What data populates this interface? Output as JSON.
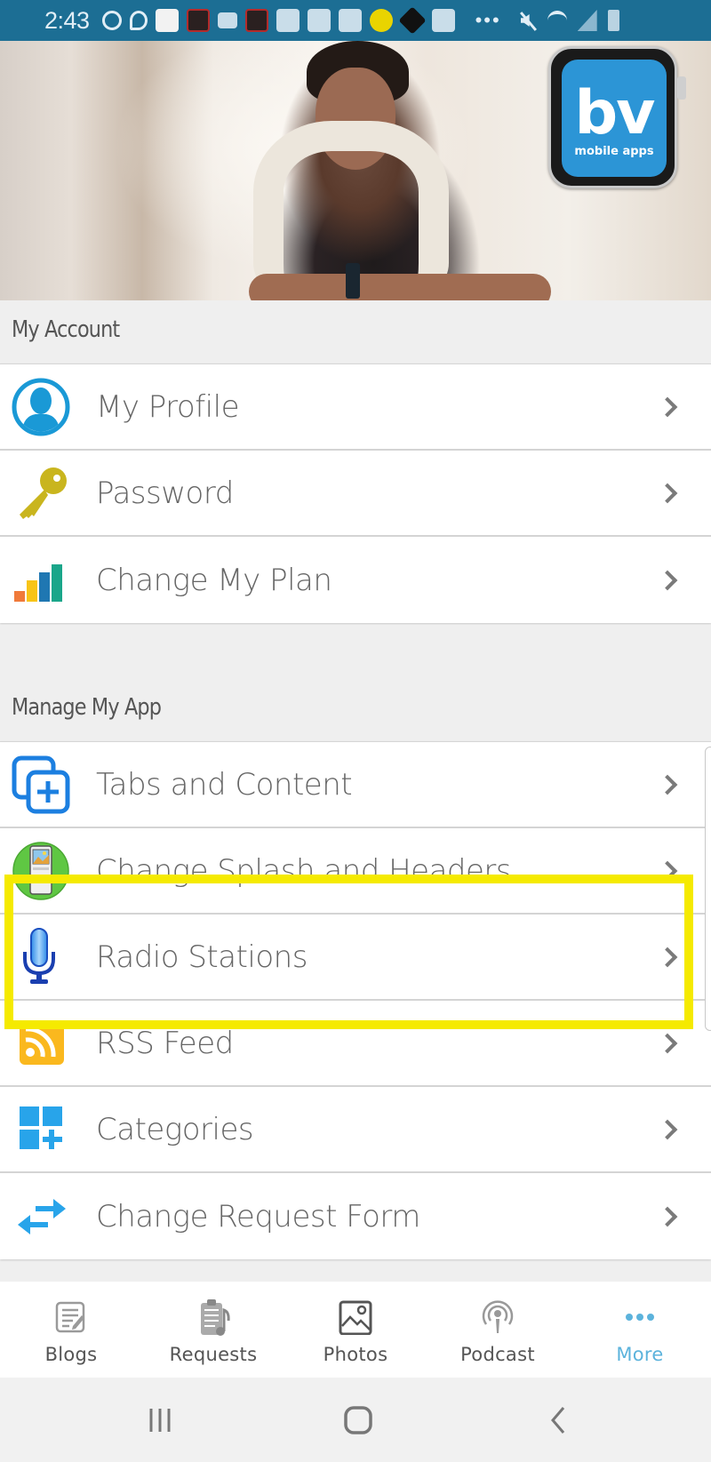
{
  "status_bar": {
    "time": "2:43",
    "notification_icons": [
      "circle-icon",
      "swirl-icon",
      "app-icon",
      "app-icon",
      "teams-icon",
      "app-icon",
      "trophy-icon",
      "app-icon",
      "trophy-icon",
      "cross-badge-icon",
      "diamond-app-icon",
      "app-icon"
    ],
    "overflow": "•••",
    "system_icons": [
      "mute-icon",
      "wifi-icon",
      "signal-icon",
      "battery-icon"
    ]
  },
  "hero": {
    "brand_letters": "bv",
    "brand_tagline": "mobile apps",
    "brand_color": "#2c95d6"
  },
  "sections": [
    {
      "title": "My Account",
      "items": [
        {
          "label": "My Profile",
          "icon": "profile-icon"
        },
        {
          "label": "Password",
          "icon": "key-icon"
        },
        {
          "label": "Change My Plan",
          "icon": "bar-chart-icon"
        }
      ]
    },
    {
      "title": "Manage My App",
      "items": [
        {
          "label": "Tabs and Content",
          "icon": "add-tabs-icon"
        },
        {
          "label": "Change Splash and Headers",
          "icon": "splash-image-icon"
        },
        {
          "label": "Radio Stations",
          "icon": "microphone-icon"
        },
        {
          "label": "RSS Feed",
          "icon": "rss-icon"
        },
        {
          "label": "Categories",
          "icon": "categories-add-icon"
        },
        {
          "label": "Change Request Form",
          "icon": "swap-arrows-icon"
        }
      ]
    }
  ],
  "highlight": {
    "target": "Radio Stations",
    "color": "#f5ea00"
  },
  "tab_bar": {
    "active_color": "#5cb3dc",
    "tabs": [
      {
        "label": "Blogs",
        "icon": "blog-icon",
        "active": false
      },
      {
        "label": "Requests",
        "icon": "requests-clipboard-icon",
        "active": false
      },
      {
        "label": "Photos",
        "icon": "photo-icon",
        "active": false
      },
      {
        "label": "Podcast",
        "icon": "podcast-icon",
        "active": false
      },
      {
        "label": "More",
        "icon": "more-dots-icon",
        "active": true
      }
    ]
  },
  "android_nav": {
    "buttons": [
      "recents-icon",
      "home-icon",
      "back-icon"
    ]
  }
}
